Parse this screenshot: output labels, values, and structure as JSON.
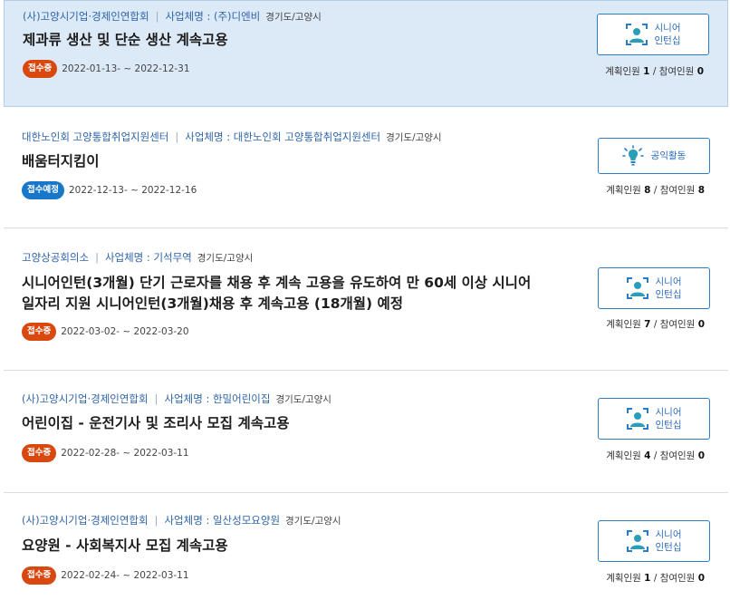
{
  "listings": [
    {
      "org": "(사)고양시기업·경제인연합회",
      "company_label": "사업체명 : (주)디엔비",
      "region": "경기도/고양시",
      "title": [
        "제과류 생산 및 단순 생산 계속고용"
      ],
      "status": "접수중",
      "status_color": "#d9480f",
      "dates": "2022-01-13- ~ 2022-12-31",
      "button": [
        "시니어",
        "인턴십"
      ],
      "icon": "senior-intern-icon",
      "plan_label": "계획인원",
      "plan": "1",
      "join_label": "참여인원",
      "join": "0"
    },
    {
      "org": "대한노인회 고양통합취업지원센터",
      "company_label": "사업체명 : 대한노인회 고양통합취업지원센터",
      "region": "경기도/고양시",
      "title": [
        "배움터지킴이"
      ],
      "status": "접수예정",
      "status_color": "#1877c9",
      "dates": "2022-12-13- ~ 2022-12-16",
      "button": [
        "공익활동"
      ],
      "icon": "lightbulb-icon",
      "plan_label": "계획인원",
      "plan": "8",
      "join_label": "참여인원",
      "join": "8"
    },
    {
      "org": "고양상공회의소",
      "company_label": "사업체명 : 기석무역",
      "region": "경기도/고양시",
      "title": [
        "시니어인턴(3개월) 단기 근로자를 채용 후 계속 고용을 유도하여 만 60세 이상 시니어",
        "일자리 지원 시니어인턴(3개월)채용 후 계속고용 (18개월) 예정"
      ],
      "status": "접수중",
      "status_color": "#d9480f",
      "dates": "2022-03-02- ~ 2022-03-20",
      "button": [
        "시니어",
        "인턴십"
      ],
      "icon": "senior-intern-icon",
      "plan_label": "계획인원",
      "plan": "7",
      "join_label": "참여인원",
      "join": "0"
    },
    {
      "org": "(사)고양시기업·경제인연합회",
      "company_label": "사업체명 : 한밀어린이집",
      "region": "경기도/고양시",
      "title": [
        "어린이집 - 운전기사 및 조리사 모집 계속고용"
      ],
      "status": "접수중",
      "status_color": "#d9480f",
      "dates": "2022-02-28- ~ 2022-03-11",
      "button": [
        "시니어",
        "인턴십"
      ],
      "icon": "senior-intern-icon",
      "plan_label": "계획인원",
      "plan": "4",
      "join_label": "참여인원",
      "join": "0"
    },
    {
      "org": "(사)고양시기업·경제인연합회",
      "company_label": "사업체명 : 일산성모요양원",
      "region": "경기도/고양시",
      "title": [
        "요양원 - 사회복지사 모집 계속고용"
      ],
      "status": "접수중",
      "status_color": "#d9480f",
      "dates": "2022-02-24- ~ 2022-03-11",
      "button": [
        "시니어",
        "인턴십"
      ],
      "icon": "senior-intern-icon",
      "plan_label": "계획인원",
      "plan": "1",
      "join_label": "참여인원",
      "join": "0"
    }
  ]
}
